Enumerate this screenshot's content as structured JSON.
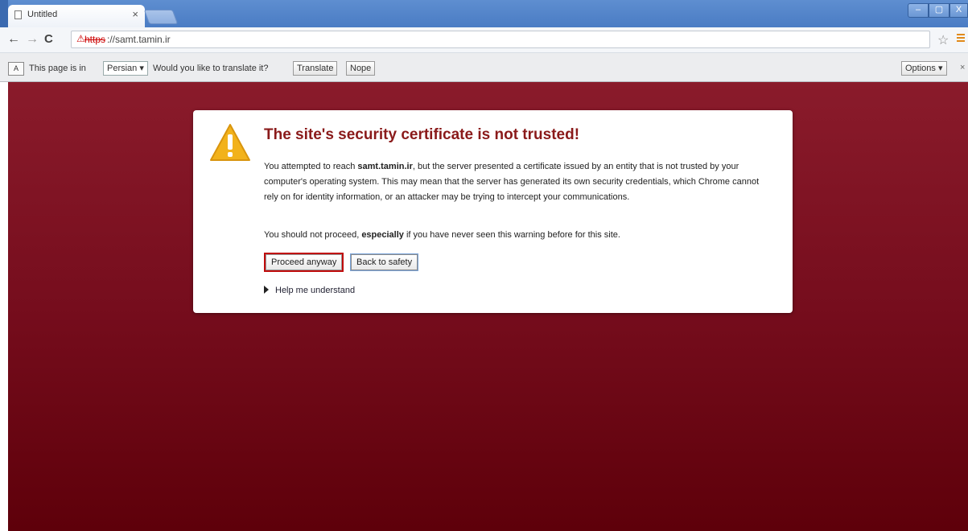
{
  "browser": {
    "tab_title": "Untitled",
    "tab_close": "×",
    "url_scheme": "https",
    "url_rest": "://samt.tamin.ir",
    "window_controls": {
      "minimize": "–",
      "maximize": "▢",
      "close": "X"
    }
  },
  "infobar": {
    "text_before": "This page is in",
    "language": "Persian ▾",
    "text_question": "Would you like to translate it?",
    "translate_label": "Translate",
    "nope_label": "Nope",
    "options_label": "Options ▾",
    "close_label": "×",
    "icon_label": "A"
  },
  "interstitial": {
    "title": "The site's security certificate is not trusted!",
    "p1_prefix": "You attempted to reach ",
    "p1_host": "samt.tamin.ir",
    "p1_suffix": ", but the server presented a certificate issued by an entity that is not trusted by your computer's operating system. This may mean that the server has generated its own security credentials, which Chrome cannot rely on for identity information, or an attacker may be trying to intercept your communications.",
    "p2_prefix": "You should not proceed, ",
    "p2_bold": "especially",
    "p2_suffix": " if you have never seen this warning before for this site.",
    "proceed_label": "Proceed anyway",
    "back_label": "Back to safety",
    "more_label": "Help me understand"
  },
  "colors": {
    "page_bg_top": "#8a1b2b",
    "page_bg_bottom": "#5e000a",
    "title": "#8a1a1a",
    "warning_icon": "#f2b21b"
  }
}
